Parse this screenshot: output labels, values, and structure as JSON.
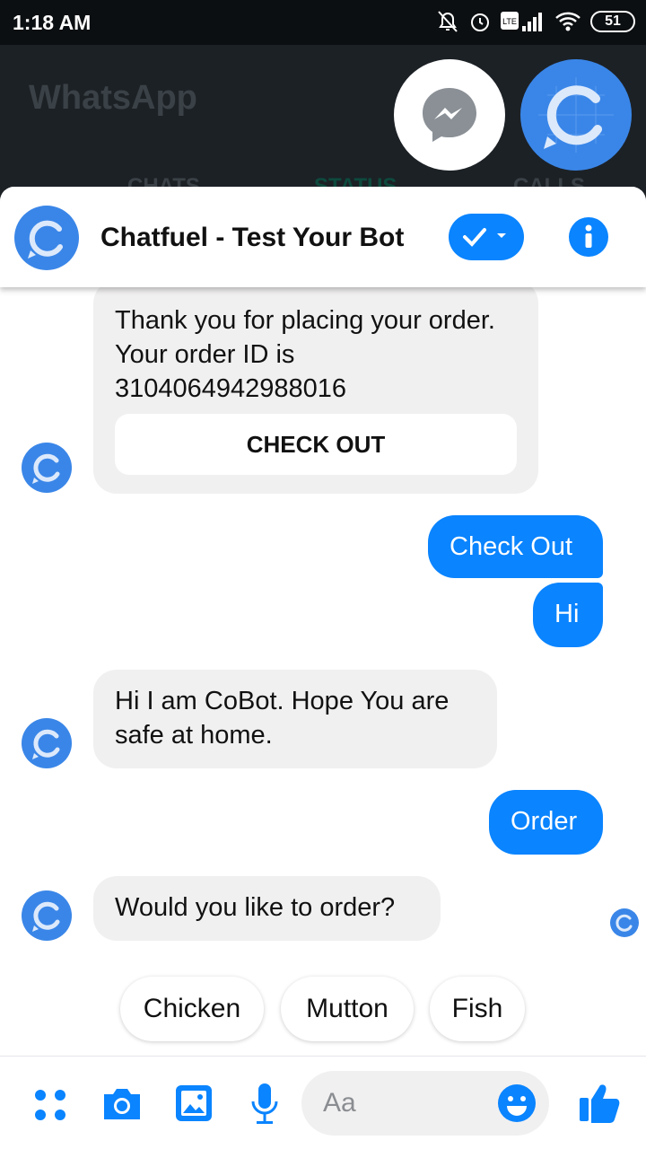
{
  "status_bar": {
    "time": "1:18 AM",
    "battery": "51"
  },
  "background_app": {
    "title": "WhatsApp",
    "tabs": [
      "CHATS",
      "STATUS",
      "CALLS"
    ]
  },
  "chat": {
    "title": "Chatfuel - Test Your Bot",
    "accent": "#0a84ff",
    "messages": [
      {
        "from": "bot",
        "text": "Thank you for placing your order. Your order ID is 3104064942988016",
        "button": "CHECK OUT"
      },
      {
        "from": "user",
        "text": "Check Out"
      },
      {
        "from": "user",
        "text": "Hi"
      },
      {
        "from": "bot",
        "text": "Hi I am CoBot. Hope You are safe at home."
      },
      {
        "from": "user",
        "text": "Order"
      },
      {
        "from": "bot",
        "text": "Would you like to order?"
      }
    ],
    "quick_replies": [
      "Chicken",
      "Mutton",
      "Fish"
    ]
  },
  "composer": {
    "placeholder": "Aa"
  }
}
